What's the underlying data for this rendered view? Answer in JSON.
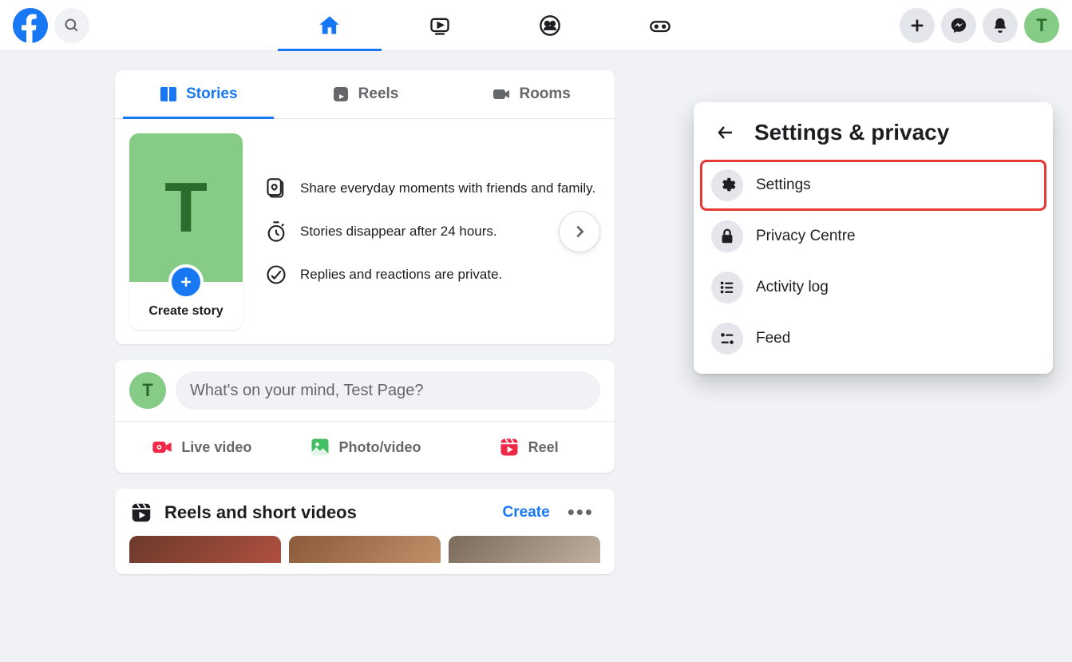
{
  "user": {
    "initial": "T"
  },
  "storyTabs": {
    "stories": "Stories",
    "reels": "Reels",
    "rooms": "Rooms"
  },
  "createStory": {
    "label": "Create story"
  },
  "storyInfo": {
    "line1": "Share everyday moments with friends and family.",
    "line2": "Stories disappear after 24 hours.",
    "line3": "Replies and reactions are private."
  },
  "composer": {
    "placeholder": "What's on your mind, Test Page?",
    "liveVideo": "Live video",
    "photoVideo": "Photo/video",
    "reel": "Reel"
  },
  "reelsSection": {
    "title": "Reels and short videos",
    "create": "Create"
  },
  "dropdown": {
    "title": "Settings & privacy",
    "items": {
      "settings": "Settings",
      "privacy": "Privacy Centre",
      "activity": "Activity log",
      "feed": "Feed"
    }
  }
}
